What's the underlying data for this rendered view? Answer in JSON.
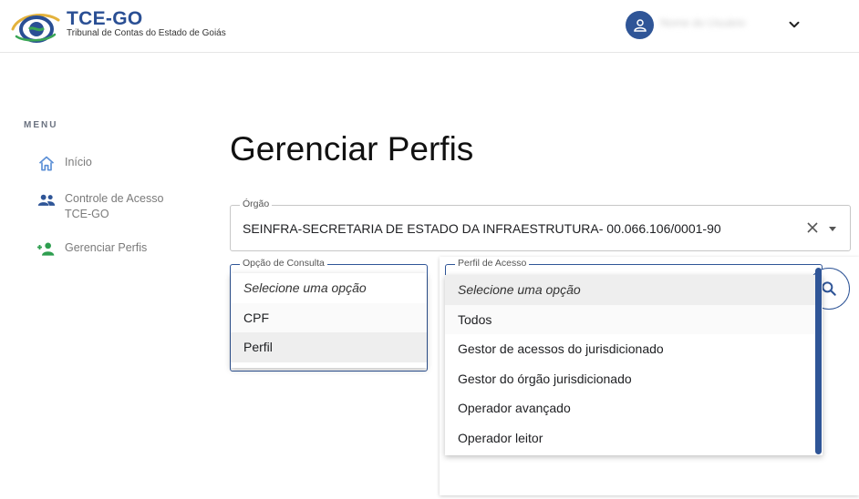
{
  "brand": {
    "title": "TCE-GO",
    "subtitle": "Tribunal de Contas do Estado de Goiás"
  },
  "user": {
    "name": "Nome do Usuário"
  },
  "sidebar": {
    "menu_label": "MENU",
    "items": [
      {
        "label": "Início",
        "icon": "home-icon"
      },
      {
        "label": "Controle de Acesso TCE-GO",
        "icon": "users-icon"
      },
      {
        "label": "Gerenciar Perfis",
        "icon": "person-add-icon"
      }
    ]
  },
  "main": {
    "title": "Gerenciar Perfis",
    "orgao": {
      "label": "Órgão",
      "value": "SEINFRA-SECRETARIA DE ESTADO DA INFRAESTRUTURA- 00.066.106/0001-90"
    },
    "opcao": {
      "label": "Opção de Consulta",
      "options": [
        "Selecione uma opção",
        "CPF",
        "Perfil"
      ]
    },
    "perfil": {
      "label": "Perfil de Acesso",
      "options": [
        "Selecione uma opção",
        "Todos",
        "Gestor de acessos do jurisdicionado",
        "Gestor do órgão jurisdicionado",
        "Operador avançado",
        "Operador leitor"
      ]
    }
  },
  "colors": {
    "accent": "#2f5597",
    "sidebar_icon": "#5b8fd6",
    "active_icon": "#2e9e4f"
  }
}
